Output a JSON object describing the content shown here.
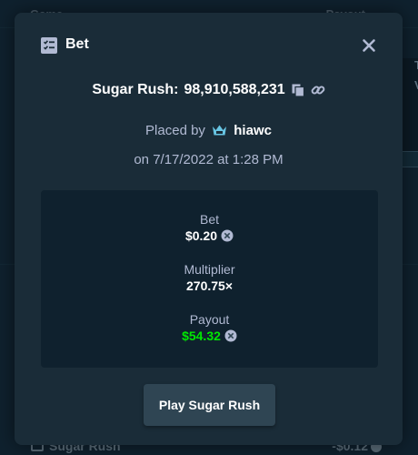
{
  "background": {
    "header": {
      "game_col": "Game",
      "payout_col": "Payout"
    },
    "footer_row": {
      "game": "Sugar Rush",
      "payout": "-$0.12"
    },
    "side_panel": {
      "line1": "T",
      "line2": "V"
    }
  },
  "modal": {
    "title": "Bet",
    "title_icon": "bet-slip-icon",
    "close_icon": "close-icon",
    "game_name": "Sugar Rush:",
    "bet_id": "98,910,588,231",
    "placed_by_prefix": "Placed by",
    "vip_icon": "vip-crown-icon",
    "username": "hiawc",
    "date": "on 7/17/2022 at 1:28 PM",
    "stats": {
      "bet_label": "Bet",
      "bet_value": "$0.20",
      "multiplier_label": "Multiplier",
      "multiplier_value": "270.75×",
      "payout_label": "Payout",
      "payout_value": "$54.32",
      "currency_icon": "currency-coin-icon"
    },
    "play_button": "Play Sugar Rush"
  },
  "colors": {
    "modal_bg": "#1a2c38",
    "stats_bg": "#0f212e",
    "button_bg": "#2f4553",
    "payout_green": "#00e701",
    "muted_text": "#b1bad3",
    "vip_blue": "#68c5e3"
  }
}
